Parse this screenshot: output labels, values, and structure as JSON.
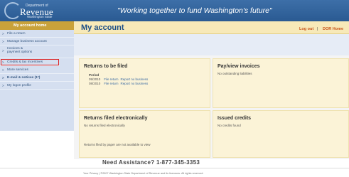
{
  "header": {
    "logo_department": "Department of",
    "logo_name": "Revenue",
    "logo_state": "Washington State",
    "tagline": "\"Working together to fund Washington's future\""
  },
  "sidebar": {
    "title": "My account home",
    "items": [
      {
        "label": "File a return"
      },
      {
        "label": "Manage business account"
      },
      {
        "label": "Invoices &",
        "label2": "payment options"
      },
      {
        "label": "Credits & tax incentives",
        "highlighted": true
      },
      {
        "label": "More services"
      },
      {
        "label": "E-mail & notices (1*)"
      },
      {
        "label": "My logon profile"
      }
    ]
  },
  "titlebar": {
    "title": "My account",
    "logout": "Log out",
    "separator": "|",
    "dor_home": "DOR Home"
  },
  "panels": {
    "returns_to_be_filed": {
      "title": "Returns to be filed",
      "period_header": "Period",
      "rows": [
        {
          "period": "09/2010",
          "action": "File return",
          "report": "Report no business"
        },
        {
          "period": "08/2010",
          "action": "File return",
          "report": "Report no business"
        }
      ]
    },
    "pay_view_invoices": {
      "title": "Pay/view invoices",
      "text": "No outstanding liabilities"
    },
    "returns_filed_electronically": {
      "title": "Returns filed electronically",
      "text": "No returns filed electronically",
      "note": "Returns filed by paper are not available to view"
    },
    "issued_credits": {
      "title": "Issued credits",
      "text": "No credits found"
    }
  },
  "assistance": "Need Assistance? 1-877-345-3353",
  "footer": "Your Privacy | ©2007 Washington State Department of Revenue and its licensors. All rights reserved.",
  "colors": {
    "header_blue": "#2a5a92",
    "accent_gold": "#c9a23a",
    "panel_bg": "#fbf3d7",
    "link_orange": "#c8541a",
    "highlight_red": "#d22"
  }
}
